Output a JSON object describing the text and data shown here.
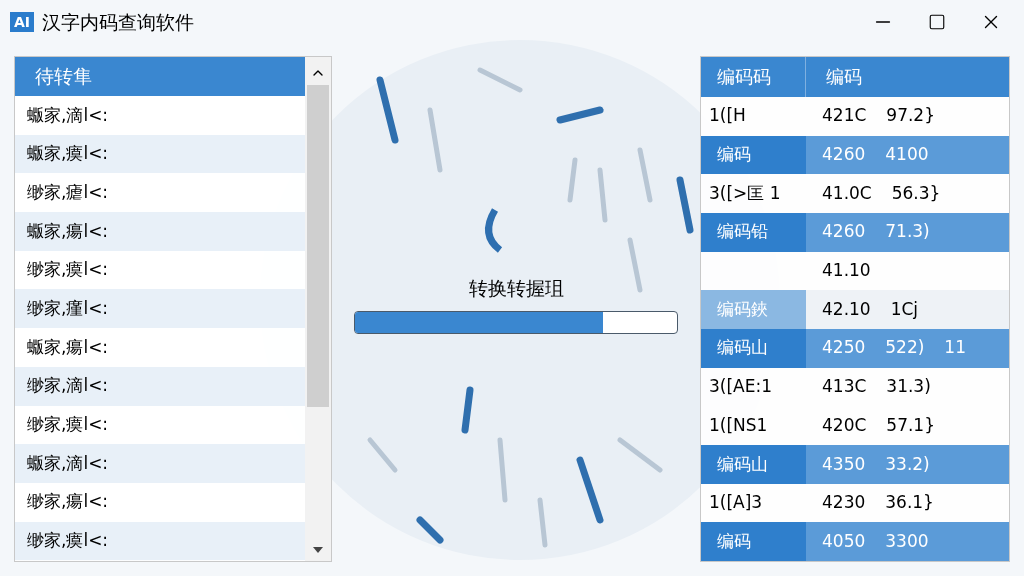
{
  "window": {
    "title": "汉字内码查询软件",
    "logo": "AI"
  },
  "source_list": {
    "header": "待转隼",
    "items": [
      {
        "text": "蝂家,滴l<:"
      },
      {
        "text": "蝂家,瘼l<:"
      },
      {
        "text": "缈家,瘧l<:"
      },
      {
        "text": "蝂家,瘍l<:"
      },
      {
        "text": "缈家,瘼l<:"
      },
      {
        "text": "缈家,瘽l<:"
      },
      {
        "text": "蝂家,瘍l<:"
      },
      {
        "text": "缈家,滴l<:"
      },
      {
        "text": "缈家,瘼l<:"
      },
      {
        "text": "蝂家,滴l<:"
      },
      {
        "text": "缈家,瘍l<:"
      },
      {
        "text": "缈家,瘼l<:"
      }
    ]
  },
  "progress": {
    "label": "转换转握珇",
    "level": 0.77
  },
  "code_table": {
    "columns": [
      "编码码",
      "编码"
    ],
    "rows": [
      {
        "kind": "plain",
        "code": "1([H",
        "values": [
          "421C",
          "97.2}"
        ]
      },
      {
        "kind": "highlight",
        "code": "编码",
        "values": [
          "4260",
          "4100"
        ]
      },
      {
        "kind": "plain",
        "code": "3([>匡 1",
        "values": [
          "41.0C",
          "56.3}"
        ]
      },
      {
        "kind": "highlight",
        "code": "编码铅",
        "values": [
          "4260",
          "71.3)"
        ]
      },
      {
        "kind": "plain",
        "values": [
          "41.10"
        ]
      },
      {
        "kind": "soft",
        "code": "编码鋏",
        "values": [
          "42.10",
          "1Cj"
        ]
      },
      {
        "kind": "highlight",
        "code": "编码山",
        "values": [
          "4250",
          "522)",
          "11"
        ]
      },
      {
        "kind": "plain",
        "code": "3([AE:1",
        "values": [
          "413C",
          "31.3)"
        ]
      },
      {
        "kind": "plain",
        "code": "1([NS1",
        "values": [
          "420C",
          "57.1}"
        ]
      },
      {
        "kind": "highlight",
        "code": "编码山",
        "values": [
          "4350",
          "33.2)"
        ]
      },
      {
        "kind": "plain",
        "code": "1([A]3",
        "values": [
          "4230",
          "36.1}"
        ]
      },
      {
        "kind": "highlight",
        "code": "编码",
        "values": [
          "4050",
          "3300"
        ]
      }
    ]
  }
}
